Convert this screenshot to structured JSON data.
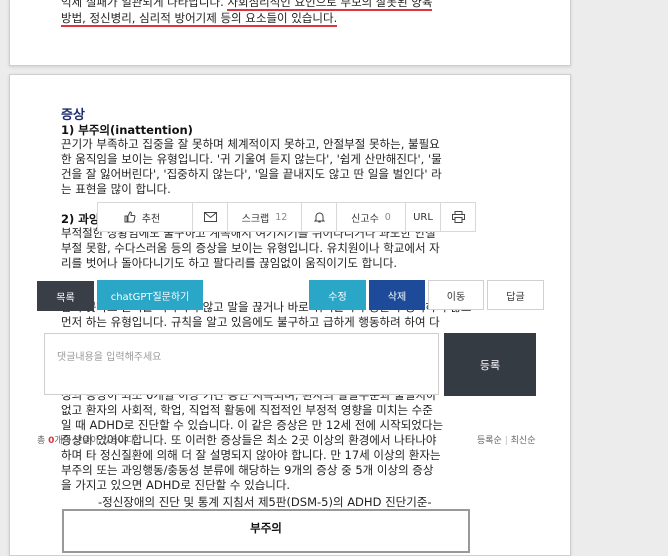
{
  "doc": {
    "top_line1_prefix": "억제 실패가 일관되게 나타납니다. ",
    "top_line1_ul": "사회심리적인 요인으로 부모의 잘못된 양육",
    "top_line2_ul": "방법, 정신병리, 심리적 방어기제 등의 요소들이 있습니다.",
    "heading": "증상",
    "sub1": "1) 부주의(inattention)",
    "p1": [
      "끈기가 부족하고 집중을 잘 못하며 체계적이지 못하고, 안절부절 못하는, 불필요",
      "한 움직임을 보이는 유형입니다. '귀 기울여 듣지 않는다', '쉽게 산만해진다', '물",
      "건을 잘 잃어버린다', '집중하지 않는다', '일을 끝내지도 않고 딴 일을 벌인다' 라",
      "는 표현을 많이 합니다."
    ],
    "sub2": "2) 과잉행동(hyperactivity)",
    "p2": [
      "부적절한 상황임에도 불구하고 계속해서 여기저기를 뛰어다니거나 과도한 안절",
      "부절 못함, 수다스러움 등의 증상을 보이는 유형입니다. 유치원이나 학교에서 자",
      "리를 벗어나 돌아다니기도 하고 팔다리를 끊임없이 움직이기도 합니다."
    ],
    "p3": [
      "참지 못하고 순서를 기다리지 않고 말을 끊거나 바로 뛰어들거나 충분히 생각하지 않고",
      "먼저 하는 유형입니다. 규칙을 알고 있음에도 불구하고 급하게 행동하려 하여 다"
    ],
    "p4": [
      "정의 증상이 최소 6개월 이상 기간 동안 지속되며, 환자의 발달수준과 불일치하",
      "없고 환자의 사회적, 학업, 직업적 활동에 직접적인 부정적 영향을 미치는 수준",
      "일 때 ADHD로 진단할 수 있습니다. 이 같은 증상은 만 12세 전에 시작되었다는",
      "증상이 있어야 합니다. 또 이러한 증상들은 최소 2곳 이상의 환경에서 나타나야",
      "하며 타 정신질환에 의해 더 잘 설명되지 않아야 합니다. 만 17세 이상의 환자는",
      "부주의 또는 과잉행동/충동성 분류에 해당하는 9개의 증상 중 5개 이상의 증상",
      "을 가지고 있으면 ADHD로 진단할 수 있습니다."
    ],
    "caption": "-정신장애의 진단 및 통계 지침서 제5판(DSM-5)의 ADHD 진단기준-",
    "table_header": "부주의"
  },
  "toolbar": {
    "like_label": "추천",
    "like_count": "",
    "scrap_label": "스크랩",
    "scrap_count": "12",
    "report_label": "신고수",
    "report_count": "0",
    "url_label": "URL"
  },
  "actions": {
    "list_label": "목록",
    "chatgpt_label": "chatGPT질문하기",
    "edit_label": "수정",
    "delete_label": "삭제",
    "move_label": "이동",
    "reply_label": "답글"
  },
  "comment": {
    "placeholder": "댓글내용을 입력해주세요",
    "submit_label": "등록",
    "total_prefix": "총 ",
    "total_count": "0",
    "total_suffix": "개의 댓글이 있습니다.",
    "sort_reg": "등록순",
    "sort_sep": "|",
    "sort_latest": "최신순"
  },
  "colors": {
    "underline": "#d9363e",
    "heading": "#1f2d6e",
    "teal": "#2aa6c7",
    "navy": "#1d4b9a",
    "dark": "#3a3f47"
  }
}
